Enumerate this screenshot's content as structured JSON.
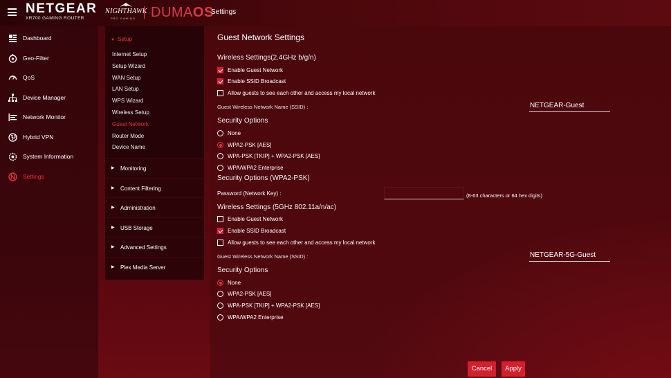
{
  "header": {
    "brand": "NETGEAR",
    "model": "XR700 GAMING ROUTER",
    "nighthawk": "NIGHTHAWK",
    "nighthawk_sub": "PRO GAMING",
    "duma": "DUMA",
    "duma_os": "OS",
    "section": "Settings",
    "accent_color": "#d93a48"
  },
  "leftnav": {
    "items": [
      {
        "label": "Dashboard",
        "icon": "dashboard-icon"
      },
      {
        "label": "Geo-Filter",
        "icon": "geo-filter-icon"
      },
      {
        "label": "QoS",
        "icon": "qos-icon"
      },
      {
        "label": "Device Manager",
        "icon": "device-manager-icon"
      },
      {
        "label": "Network Monitor",
        "icon": "network-monitor-icon"
      },
      {
        "label": "Hybrid VPN",
        "icon": "hybrid-vpn-icon"
      },
      {
        "label": "System Information",
        "icon": "system-info-icon"
      },
      {
        "label": "Settings",
        "icon": "settings-icon"
      }
    ],
    "active": "Settings"
  },
  "subnav": {
    "open_group": "Setup",
    "setup_items": [
      "Internet Setup",
      "Setup Wizard",
      "WAN Setup",
      "LAN Setup",
      "WPS Wizard",
      "Wireless Setup",
      "Guest Network",
      "Router Mode",
      "Device Name"
    ],
    "active_item": "Guest Network",
    "groups": [
      "Monitoring",
      "Content Filtering",
      "Administration",
      "USB Storage",
      "Advanced Settings",
      "Plex Media Server"
    ]
  },
  "main": {
    "title": "Guest Network Settings",
    "band24": {
      "title": "Wireless Settings(2.4GHz b/g/n)",
      "enable_guest": {
        "label": "Enable Guest Network",
        "checked": true
      },
      "enable_ssid": {
        "label": "Enable SSID Broadcast",
        "checked": true
      },
      "allow_local": {
        "label": "Allow guests to see each other and access my local network",
        "checked": false
      },
      "ssid_label": "Guest Wireless Network Name (SSID) :",
      "ssid_value": "NETGEAR-Guest",
      "security_title": "Security Options",
      "security_options": [
        "None",
        "WPA2-PSK [AES]",
        "WPA-PSK [TKIP] + WPA2-PSK [AES]",
        "WPA/WPA2 Enterprise"
      ],
      "security_selected": "WPA2-PSK [AES]",
      "security_sub_title": "Security Options (WPA2-PSK)",
      "password_label": "Password (Network Key) :",
      "password_value": "",
      "password_hint": "(8-63 characters or 64 hex digits)"
    },
    "band5": {
      "title": "Wireless Settings (5GHz 802.11a/n/ac)",
      "enable_guest": {
        "label": "Enable Guest Network",
        "checked": false
      },
      "enable_ssid": {
        "label": "Enable SSID Broadcast",
        "checked": true
      },
      "allow_local": {
        "label": "Allow guests to see each other and access my local network",
        "checked": false
      },
      "ssid_label": "Guest Wireless Network Name (SSID) :",
      "ssid_value": "NETGEAR-5G-Guest",
      "security_title": "Security Options",
      "security_options": [
        "None",
        "WPA2-PSK [AES]",
        "WPA-PSK [TKIP] + WPA2-PSK [AES]",
        "WPA/WPA2 Enterprise"
      ],
      "security_selected": "None"
    },
    "buttons": {
      "cancel": "Cancel",
      "apply": "Apply"
    }
  }
}
